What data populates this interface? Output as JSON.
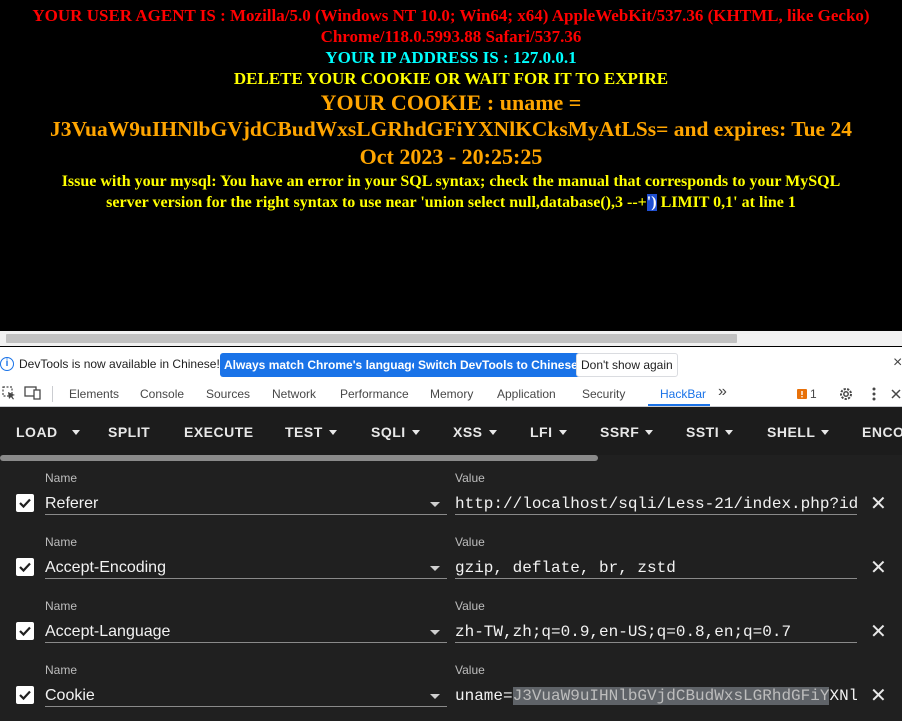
{
  "page": {
    "ua_line1": "YOUR USER AGENT IS : Mozilla/5.0 (Windows NT 10.0; Win64; x64) AppleWebKit/537.36 (KHTML, like Gecko)",
    "ua_line2": "Chrome/118.0.5993.88 Safari/537.36",
    "ip_line": "YOUR IP ADDRESS IS : 127.0.0.1",
    "delete_line": "DELETE YOUR COOKIE OR WAIT FOR IT TO EXPIRE",
    "cookie_line1": "YOUR COOKIE : uname =",
    "cookie_line2": "J3VuaW9uIHNlbGVjdCBudWxsLGRhdGFiYXNlKCksMyAtLSs= and expires: Tue 24",
    "cookie_line3": "Oct 2023 - 20:25:25",
    "error_line1": "Issue with your mysql: You have an error in your SQL syntax; check the manual that corresponds to your MySQL",
    "error_line2_a": "server version for the right syntax to use near 'union select null,database(),3 --+",
    "error_line2_sel": "')",
    "error_line2_b": " LIMIT 0,1' at line 1"
  },
  "notice": {
    "info_icon": "i",
    "message": "DevTools is now available in Chinese!",
    "btn_match": "Always match Chrome's language",
    "btn_switch": "Switch DevTools to Chinese",
    "btn_dont": "Don't show again",
    "close": "×"
  },
  "devtools": {
    "tabs": [
      "Elements",
      "Console",
      "Sources",
      "Network",
      "Performance",
      "Memory",
      "Application",
      "Security",
      "HackBar"
    ],
    "more": "»",
    "issues_count": "1"
  },
  "hackbar": {
    "toolbar": [
      "LOAD",
      "SPLIT",
      "EXECUTE",
      "TEST",
      "SQLI",
      "XSS",
      "LFI",
      "SSRF",
      "SSTI",
      "SHELL",
      "ENCO"
    ],
    "name_label": "Name",
    "value_label": "Value",
    "headers": [
      {
        "name": "Referer",
        "value": "http://localhost/sqli/Less-21/index.php?id"
      },
      {
        "name": "Accept-Encoding",
        "value": "gzip, deflate, br, zstd"
      },
      {
        "name": "Accept-Language",
        "value": "zh-TW,zh;q=0.9,en-US;q=0.8,en;q=0.7"
      },
      {
        "name": "Cookie",
        "value_prefix": "uname=",
        "value_selected": "J3VuaW9uIHNlbGVjdCBudWxsLGRhdGFiY",
        "value_rest": "XNl"
      }
    ]
  }
}
